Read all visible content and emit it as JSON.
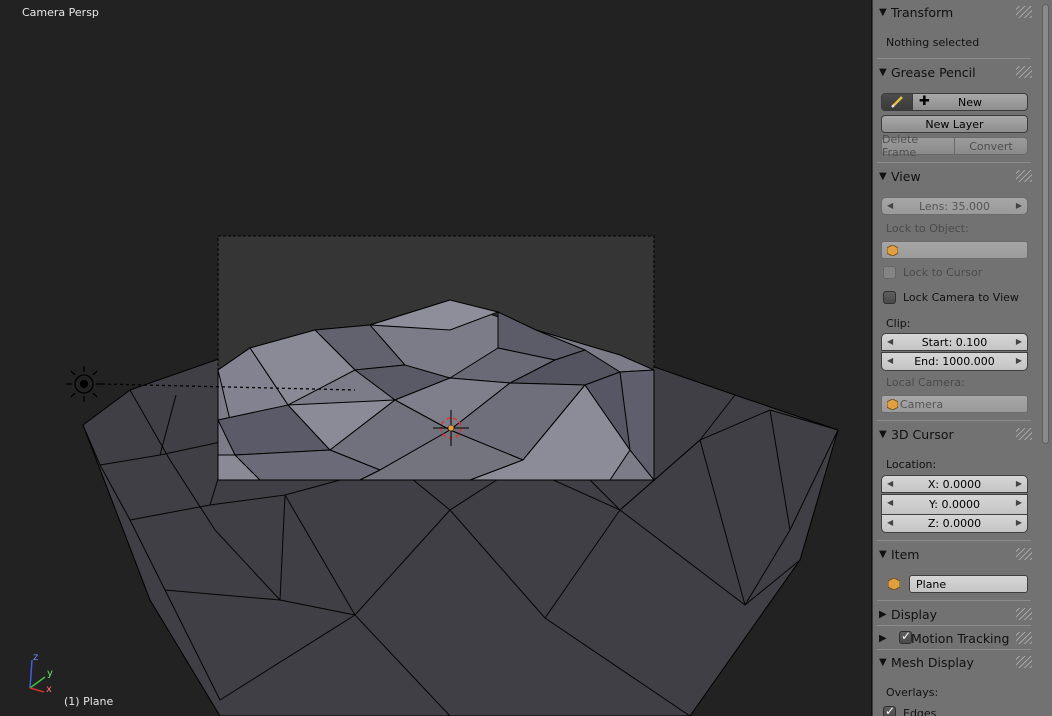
{
  "viewport": {
    "title": "Camera Persp",
    "active_object_label": "(1) Plane",
    "axes": {
      "x": "x",
      "y": "y",
      "z": "z"
    }
  },
  "sidebar": {
    "transform": {
      "title": "Transform",
      "status": "Nothing selected"
    },
    "grease_pencil": {
      "title": "Grease Pencil",
      "new_label": "New",
      "new_layer_label": "New Layer",
      "delete_frame_label": "Delete Frame",
      "convert_label": "Convert"
    },
    "view": {
      "title": "View",
      "lens": "Lens: 35.000",
      "lock_to_object_label": "Lock to Object:",
      "lock_to_cursor_label": "Lock to Cursor",
      "lock_camera_label": "Lock Camera to View",
      "clip_label": "Clip:",
      "clip_start": "Start: 0.100",
      "clip_end": "End: 1000.000",
      "local_camera_label": "Local Camera:",
      "local_camera_value": "Camera"
    },
    "cursor_3d": {
      "title": "3D Cursor",
      "location_label": "Location:",
      "x": "X: 0.0000",
      "y": "Y: 0.0000",
      "z": "Z: 0.0000"
    },
    "item": {
      "title": "Item",
      "name": "Plane"
    },
    "display": {
      "title": "Display"
    },
    "motion_tracking": {
      "title": "Motion Tracking",
      "checked": true
    },
    "mesh_display": {
      "title": "Mesh Display",
      "overlays_label": "Overlays:",
      "edges_label": "Edges",
      "edges_checked": true
    }
  },
  "colors": {
    "viewport_bg": "#222222",
    "sidebar_bg": "#727272",
    "mesh_face": "#3c3c42",
    "mesh_face_in_camera": "#7a7a86",
    "axis_x": "#d03030",
    "axis_y": "#40c040",
    "axis_z": "#4060e0"
  }
}
